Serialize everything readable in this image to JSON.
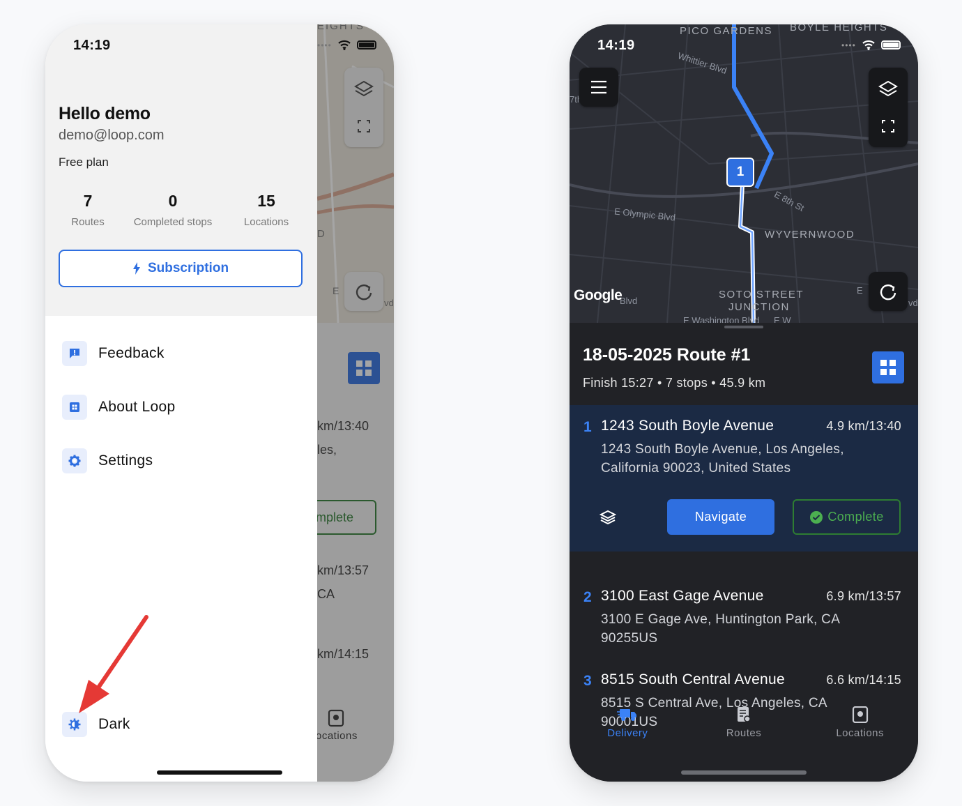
{
  "left_phone": {
    "status_time": "14:19",
    "background_app": {
      "map_label_top": "EIGHTS",
      "map_label_mid": "D",
      "map_label_low1": "E",
      "map_label_low2": "vd",
      "stop1_dist": "km/13:40",
      "stop1_addr": "les,",
      "complete_label": "mplete",
      "stop2_dist": "km/13:57",
      "stop2_addr": "CA",
      "stop3_dist": "km/14:15",
      "tab_label": "ocations"
    },
    "drawer": {
      "user_name": "Hello demo",
      "user_email": "demo@loop.com",
      "plan": "Free plan",
      "stats": [
        {
          "value": "7",
          "label": "Routes"
        },
        {
          "value": "0",
          "label": "Completed stops"
        },
        {
          "value": "15",
          "label": "Locations"
        }
      ],
      "subscription_label": "Subscription",
      "menu": [
        {
          "label": "Feedback",
          "icon": "feedback-icon"
        },
        {
          "label": "About Loop",
          "icon": "about-icon"
        },
        {
          "label": "Settings",
          "icon": "gear-icon"
        }
      ],
      "theme_label": "Dark"
    },
    "arrow_color": "#e53935"
  },
  "right_phone": {
    "status_time": "14:19",
    "map": {
      "labels": [
        "PICO GARDENS",
        "BOYLE HEIGHTS",
        "WYVERNWOOD",
        "SOTO STREET",
        "JUNCTION"
      ],
      "streets": [
        "Whittier Blvd",
        "E 8th St",
        "E Olympic Blvd",
        "E Washington Blvd",
        "7th",
        "Blvd",
        "E",
        "vd",
        "E W"
      ],
      "pin_label": "1",
      "google": "Google",
      "route_color": "#3b82f6"
    },
    "route": {
      "title": "18-05-2025 Route #1",
      "meta": "Finish 15:27 • 7 stops • 45.9 km"
    },
    "stops": [
      {
        "num": "1",
        "name": "1243 South Boyle Avenue",
        "dist": "4.9 km/13:40",
        "addr": "1243 South Boyle Avenue, Los Angeles, California 90023, United States"
      },
      {
        "num": "2",
        "name": "3100 East Gage Avenue",
        "dist": "6.9 km/13:57",
        "addr": "3100 E Gage Ave, Huntington Park, CA 90255US"
      },
      {
        "num": "3",
        "name": "8515 South Central Avenue",
        "dist": "6.6 km/14:15",
        "addr": "8515 S Central Ave, Los Angeles, CA 90001US"
      }
    ],
    "actions": {
      "navigate": "Navigate",
      "complete": "Complete"
    },
    "tabs": [
      {
        "label": "Delivery",
        "active": true
      },
      {
        "label": "Routes",
        "active": false
      },
      {
        "label": "Locations",
        "active": false
      }
    ],
    "accent": "#2f6fe0"
  }
}
